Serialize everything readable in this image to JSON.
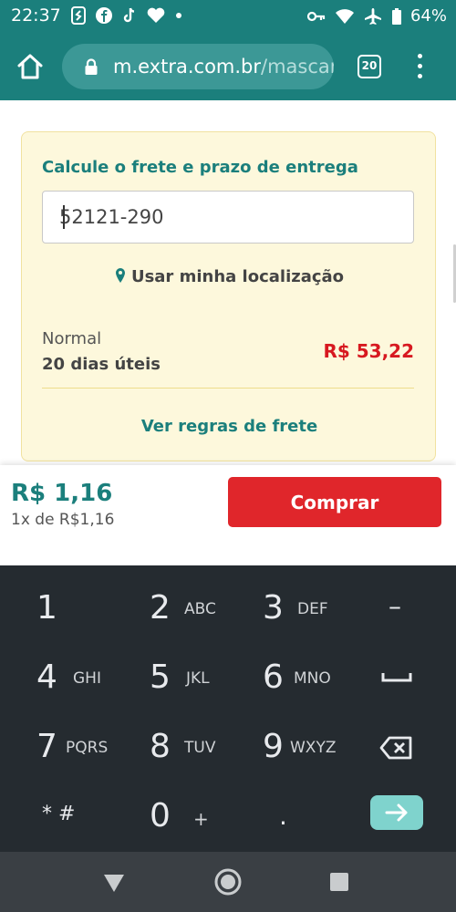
{
  "status_bar": {
    "time": "22:37",
    "battery": "64%",
    "icons_left": [
      "shazam-icon",
      "facebook-icon",
      "tiktok-icon",
      "heart-icon",
      "dot-icon"
    ],
    "icons_right": [
      "vpn-key-icon",
      "wifi-icon",
      "airplane-icon",
      "battery-icon"
    ]
  },
  "browser": {
    "url_host": "m.extra.com.br",
    "url_path": "/mascar",
    "tab_count": "20"
  },
  "shipping": {
    "title": "Calcule o frete e prazo de entrega",
    "cep_value": "52121-290",
    "use_location_label": "Usar minha localização",
    "method_name": "Normal",
    "method_days": "20 dias úteis",
    "method_price": "R$ 53,22",
    "rules_link": "Ver regras de frete"
  },
  "purchase": {
    "price": "R$ 1,16",
    "installment": "1x de R$1,16",
    "buy_label": "Comprar"
  },
  "keyboard": {
    "keys": [
      {
        "digit": "1",
        "letters": ""
      },
      {
        "digit": "2",
        "letters": "ABC"
      },
      {
        "digit": "3",
        "letters": "DEF"
      },
      {
        "digit": "4",
        "letters": "GHI"
      },
      {
        "digit": "5",
        "letters": "JKL"
      },
      {
        "digit": "6",
        "letters": "MNO"
      },
      {
        "digit": "7",
        "letters": "PQRS"
      },
      {
        "digit": "8",
        "letters": "TUV"
      },
      {
        "digit": "9",
        "letters": "WXYZ"
      },
      {
        "digit": "0",
        "letters": "+"
      }
    ],
    "symbols": {
      "minus": "–",
      "star_hash": "* #",
      "period": "."
    }
  },
  "colors": {
    "brand_teal": "#1b7f7c",
    "buy_red": "#e0262b",
    "price_red": "#d71920",
    "card_bg": "#fdf8dc",
    "keyboard_bg": "#252b30",
    "enter_key": "#7fd3cd"
  }
}
